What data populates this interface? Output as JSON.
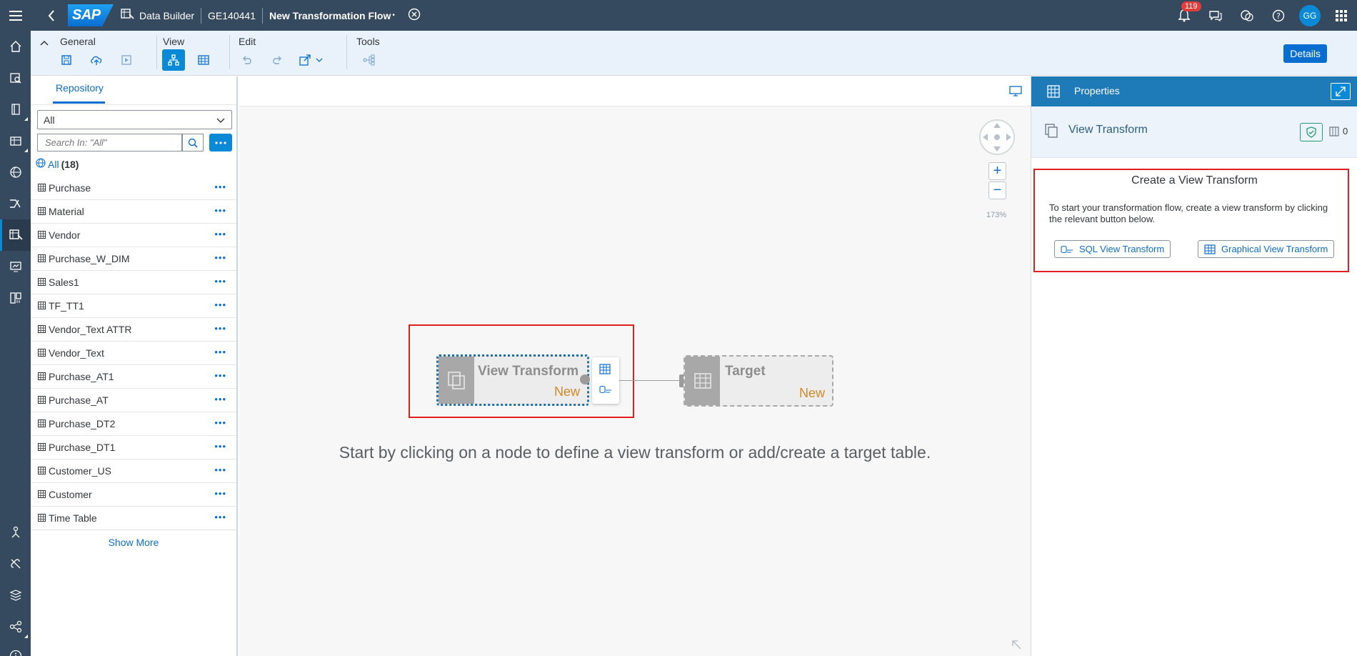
{
  "shell": {
    "logo_text": "SAP",
    "app_name": "Data Builder",
    "space": "GE140441",
    "flow_title": "New Transformation Flow",
    "flow_title_marker": "•",
    "notifications_count": "119",
    "avatar_initials": "GG"
  },
  "toolbar": {
    "groups": {
      "general": "General",
      "view": "View",
      "edit": "Edit",
      "tools": "Tools"
    },
    "details_label": "Details"
  },
  "repository": {
    "tab_label": "Repository",
    "filter_value": "All",
    "search_placeholder": "Search In: \"All\"",
    "all_label": "All",
    "all_count": "(18)",
    "items": [
      {
        "label": "Purchase"
      },
      {
        "label": "Material"
      },
      {
        "label": "Vendor"
      },
      {
        "label": "Purchase_W_DIM"
      },
      {
        "label": "Sales1"
      },
      {
        "label": "TF_TT1"
      },
      {
        "label": "Vendor_Text ATTR"
      },
      {
        "label": "Vendor_Text"
      },
      {
        "label": "Purchase_AT1"
      },
      {
        "label": "Purchase_AT"
      },
      {
        "label": "Purchase_DT2"
      },
      {
        "label": "Purchase_DT1"
      },
      {
        "label": "Customer_US"
      },
      {
        "label": "Customer"
      },
      {
        "label": "Time Table"
      }
    ],
    "show_more": "Show More"
  },
  "canvas": {
    "zoom_level": "173%",
    "view_transform_node": {
      "name": "View Transform",
      "status": "New"
    },
    "target_node": {
      "name": "Target",
      "status": "New"
    },
    "hint": "Start by clicking on a node to define a view transform or add/create a target table."
  },
  "properties": {
    "header_title": "Properties",
    "object_name": "View Transform",
    "column_count": "0",
    "create_title": "Create a View Transform",
    "create_desc": "To start your transformation flow, create a view transform by clicking the relevant button below.",
    "sql_button": "SQL View Transform",
    "graphical_button": "Graphical View Transform"
  },
  "colors": {
    "shell_bg": "#354a5f",
    "accent": "#0a6ed1",
    "highlight_border": "#e02020",
    "status_new": "#d08a28"
  }
}
